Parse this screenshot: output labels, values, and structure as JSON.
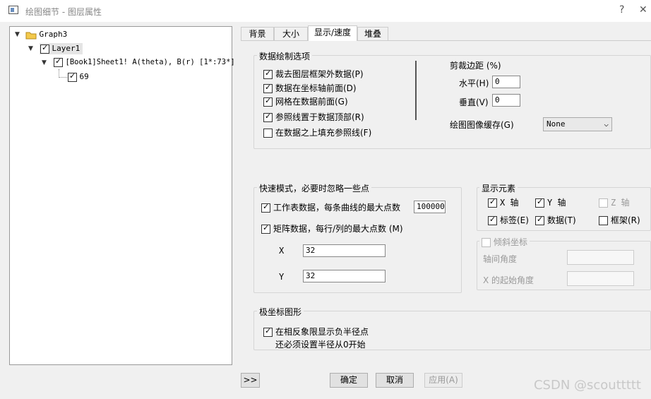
{
  "window": {
    "title": "绘图细节 - 图层属性",
    "help": "?",
    "close": "✕"
  },
  "tree": {
    "graph": "Graph3",
    "layer": "Layer1",
    "plot": "[Book1]Sheet1! A(theta), B(r) [1*:73*]",
    "point": "69"
  },
  "tabs": [
    "背景",
    "大小",
    "显示/速度",
    "堆叠"
  ],
  "data_draw": {
    "title": "数据绘制选项",
    "options": [
      {
        "label": "裁去图层框架外数据(P)",
        "checked": true
      },
      {
        "label": "数据在坐标轴前面(D)",
        "checked": true
      },
      {
        "label": "网格在数据前面(G)",
        "checked": true
      },
      {
        "label": "参照线置于数据顶部(R)",
        "checked": true
      },
      {
        "label": "在数据之上填充参照线(F)",
        "checked": false
      }
    ]
  },
  "clip": {
    "title": "剪裁边距 (%)",
    "h_label": "水平(H)",
    "h_value": "0",
    "v_label": "垂直(V)",
    "v_value": "0"
  },
  "cache": {
    "label": "绘图图像缓存(G)",
    "value": "None"
  },
  "speed": {
    "title": "快速模式，必要时忽略一些点",
    "worksheet_label": "工作表数据，每条曲线的最大点数",
    "worksheet_value": "100000",
    "matrix_label": "矩阵数据，每行/列的最大点数 (M)",
    "x_label": "X",
    "x_value": "32",
    "y_label": "Y",
    "y_value": "32"
  },
  "display": {
    "title": "显示元素",
    "items": [
      {
        "label": "X 轴",
        "checked": true,
        "enabled": true
      },
      {
        "label": "Y 轴",
        "checked": true,
        "enabled": true
      },
      {
        "label": "Z 轴",
        "checked": false,
        "enabled": false
      },
      {
        "label": "标签(E)",
        "checked": true,
        "enabled": true
      },
      {
        "label": "数据(T)",
        "checked": true,
        "enabled": true
      },
      {
        "label": "框架(R)",
        "checked": false,
        "enabled": true
      }
    ]
  },
  "oblique": {
    "title": "倾斜坐标",
    "axis_angle": "轴间角度",
    "x_start": "X 的起始角度"
  },
  "polar": {
    "title": "极坐标图形",
    "option": "在相反象限显示负半径点",
    "note": "还必须设置半径从0开始"
  },
  "buttons": {
    "expand": ">>",
    "ok": "确定",
    "cancel": "取消",
    "apply": "应用(A)"
  },
  "watermark": "CSDN @scouttttt"
}
